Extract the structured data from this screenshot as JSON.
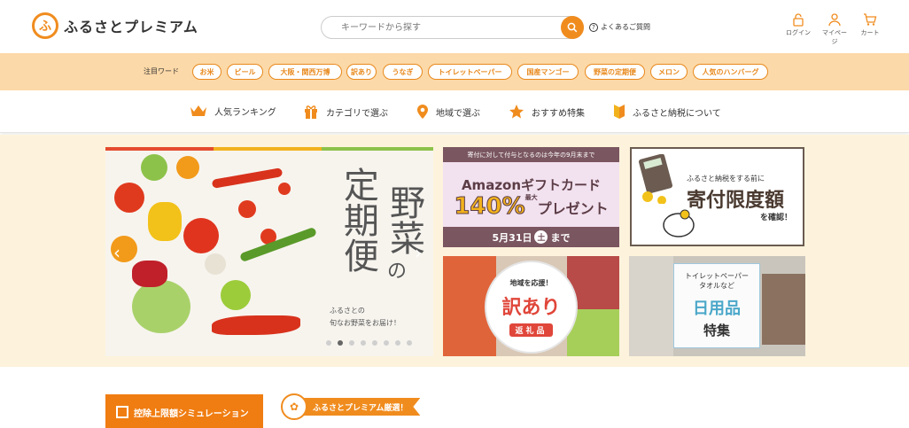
{
  "header": {
    "logo_text": "ふるさとプレミアム",
    "logo_mark": "ふ",
    "search": {
      "placeholder": "キーワードから探す"
    },
    "faq_label": "よくあるご質問",
    "icons": [
      {
        "name": "lock-icon",
        "label": "ログイン"
      },
      {
        "name": "user-icon",
        "label": "マイページ"
      },
      {
        "name": "cart-icon",
        "label": "カート"
      }
    ]
  },
  "keywords": {
    "label": "注目ワード",
    "items": [
      "お米",
      "ビール",
      "大阪・関西万博",
      "訳あり",
      "うなぎ",
      "トイレットペーパー",
      "国産マンゴー",
      "野菜の定期便",
      "メロン",
      "人気のハンバーグ"
    ]
  },
  "nav": {
    "items": [
      {
        "label": "人気ランキング",
        "icon": "crown-icon"
      },
      {
        "label": "カテゴリで選ぶ",
        "icon": "gift-icon"
      },
      {
        "label": "地域で選ぶ",
        "icon": "map-pin-icon"
      },
      {
        "label": "おすすめ特集",
        "icon": "star-icon"
      },
      {
        "label": "ふるさと納税について",
        "icon": "beginner-mark-icon"
      }
    ]
  },
  "hero": {
    "slide": {
      "title_col1": "野菜",
      "title_col2": "定期便",
      "title_no": "の",
      "subtitle_line1": "ふるさとの",
      "subtitle_line2": "旬なお野菜をお届け！",
      "prev_arrow": "‹",
      "next_arrow": "›",
      "slide_count": 8,
      "active_index": 1
    },
    "amazon": {
      "top": "寄付に対して付与となるのは今年の9月末まで",
      "title": "Amazonギフトカード",
      "percent": "140",
      "percent_suffix": "%",
      "percent_note": "最大",
      "present": "プレゼント",
      "date": "5月31日",
      "weekday": "土",
      "until": "まで"
    },
    "limit": {
      "sub": "ふるさと納税をする前に",
      "title": "寄付限度額",
      "confirm": "を確認！"
    },
    "wake": {
      "top": "地域を応援！",
      "main": "訳あり",
      "bottom": "返礼品"
    },
    "daily": {
      "top_line1": "トイレットペーパー",
      "top_line2": "タオルなど",
      "main": "日用品",
      "bottom": "特集"
    }
  },
  "below": {
    "simulation_button": "控除上限額シミュレーション",
    "premium_tag": "ふるさとプレミアム厳選！"
  },
  "colors": {
    "accent": "#f08c1e",
    "keyword_bar": "#fcd9a8",
    "hero_bg": "#fdf3dc"
  }
}
